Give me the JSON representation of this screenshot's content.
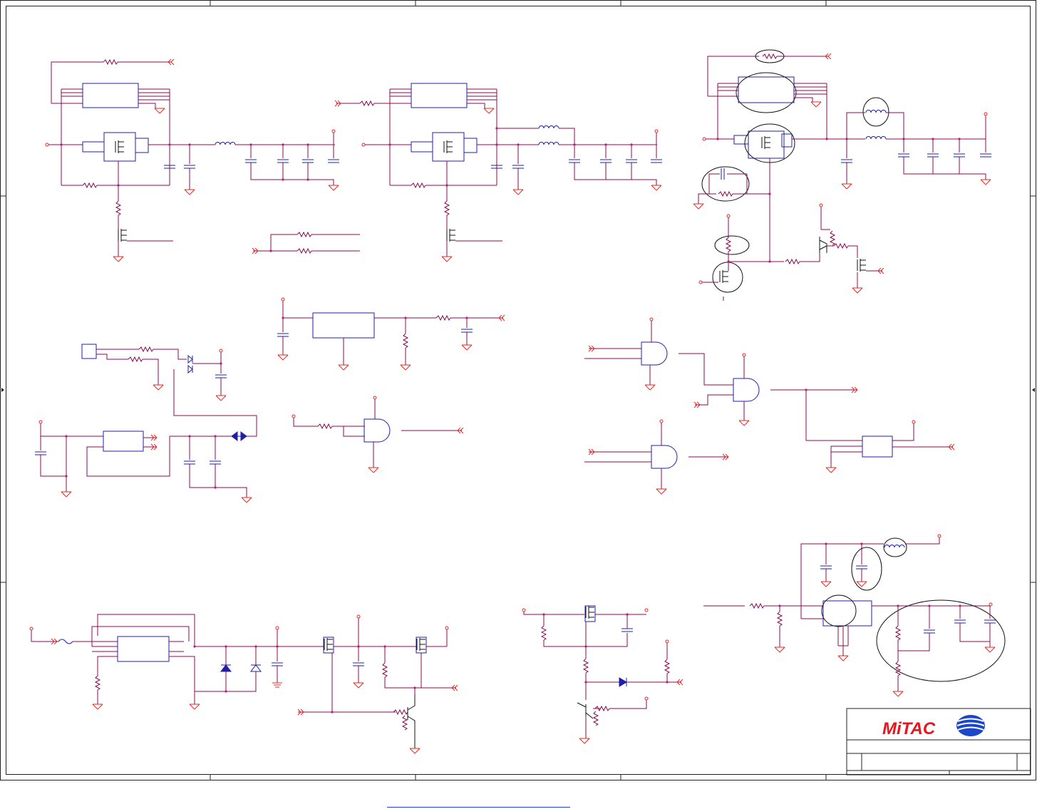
{
  "title_block": {
    "logo_text": "MiTAC",
    "brand_color": "#e8141e",
    "globe_color": "#1b47c8"
  },
  "colors": {
    "wire": "#8b0a50",
    "power_ground": "#e8281f",
    "component": "#1f1fa8",
    "frame": "#222222"
  },
  "icons": [
    "ground-symbol-icon",
    "power-pin-icon",
    "offpage-connector-icon",
    "mosfet-icon",
    "and-gate-icon",
    "transistor-icon",
    "diode-icon",
    "resistor-icon",
    "capacitor-icon",
    "inductor-icon",
    "bidirectional-arrow-icon"
  ]
}
